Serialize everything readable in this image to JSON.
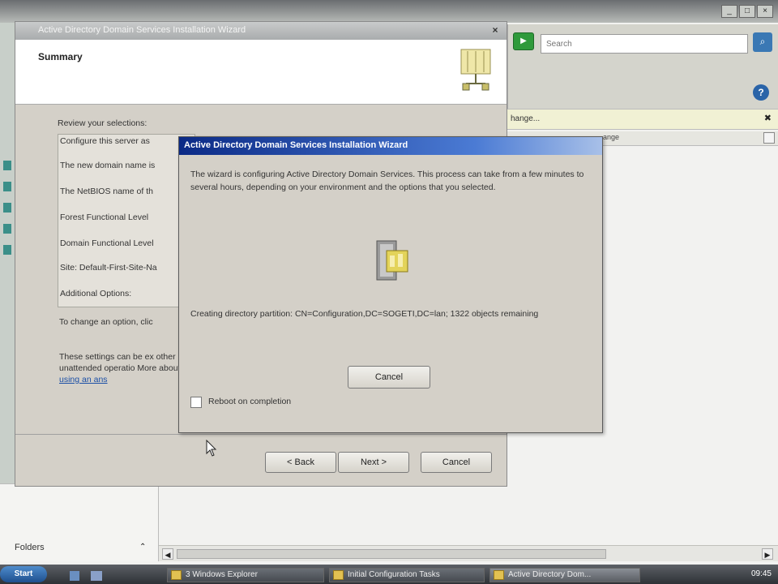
{
  "explorer": {
    "search_placeholder": "Search",
    "info_bar_text": "hange...",
    "column_header_text": "ange",
    "folders_label": "Folders"
  },
  "back_wizard": {
    "title": "Active Directory Domain Services Installation Wizard",
    "heading": "Summary",
    "review_label": "Review your selections:",
    "rows": [
      "Configure this server as",
      "The new domain name is",
      "The NetBIOS name of th",
      "Forest Functional Level",
      "Domain Functional Level",
      "Site: Default-First-Site-Na",
      "Additional Options:"
    ],
    "change_text": "To change an option, clic",
    "note_text": "These settings can be ex other unattended operatio More about",
    "note_link": "using an ans",
    "back_button": "< Back",
    "next_button": "Next >",
    "cancel_button": "Cancel"
  },
  "progress_dialog": {
    "title": "Active Directory Domain Services Installation Wizard",
    "description": "The wizard is configuring Active Directory Domain Services. This process can take from a few minutes to several hours, depending on your environment and the options that you selected.",
    "status": "Creating directory partition: CN=Configuration,DC=SOGETI,DC=lan; 1322 objects remaining",
    "cancel_button": "Cancel",
    "reboot_label": "Reboot on completion",
    "reboot_checked": false
  },
  "taskbar": {
    "start_label": "Start",
    "items": [
      "3 Windows Explorer",
      "Initial Configuration Tasks",
      "Active Directory Dom..."
    ],
    "clock": "09:45"
  }
}
